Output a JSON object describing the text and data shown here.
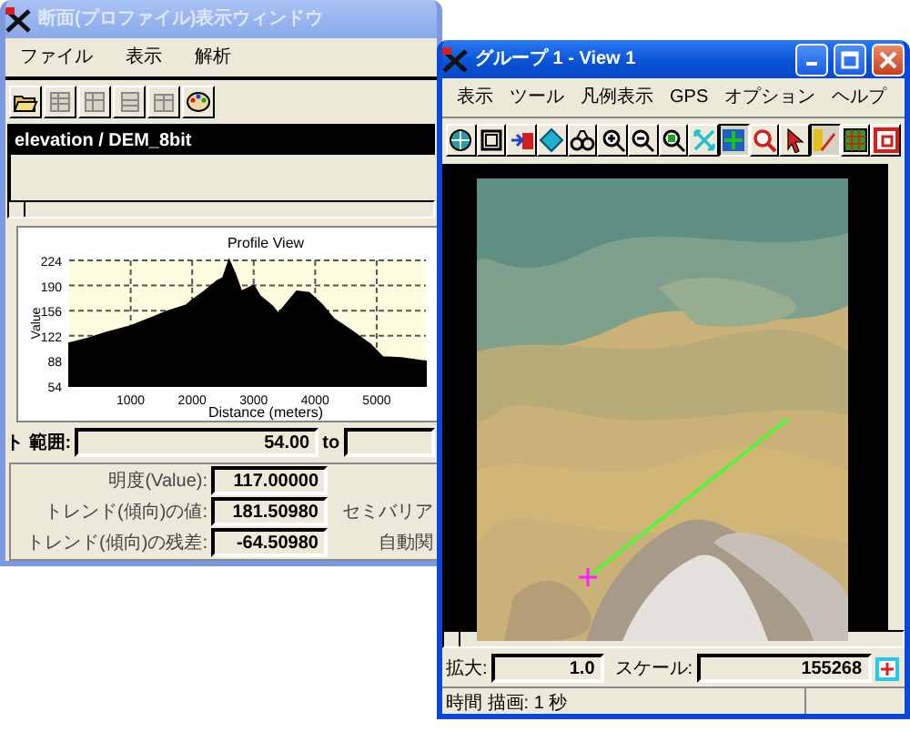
{
  "profile_window": {
    "title": "断面(プロファイル)表示ウィンドウ",
    "active": false,
    "menu": [
      "ファイル",
      "表示",
      "解析"
    ],
    "layers": [
      {
        "label": "elevation / DEM_8bit",
        "selected": true
      }
    ],
    "chart": {
      "chart_data": {
        "type": "area",
        "title": "Profile View",
        "xlabel": "Distance (meters)",
        "ylabel": "Value",
        "x": [
          0,
          300,
          600,
          1000,
          1300,
          1600,
          1900,
          2000,
          2200,
          2400,
          2500,
          2600,
          2700,
          2800,
          2900,
          3000,
          3100,
          3300,
          3400,
          3500,
          3700,
          3900,
          4100,
          4300,
          4600,
          4900,
          5100,
          5400,
          5800
        ],
        "values": [
          112,
          118,
          126,
          135,
          145,
          155,
          163,
          170,
          182,
          196,
          200,
          224,
          205,
          182,
          186,
          190,
          176,
          162,
          152,
          162,
          182,
          180,
          165,
          145,
          128,
          110,
          93,
          92,
          87
        ],
        "xlim": [
          0,
          5800
        ],
        "ylim": [
          54,
          224
        ],
        "grid": true,
        "xticks": [
          1000,
          2000,
          3000,
          4000,
          5000
        ],
        "yticks": [
          54,
          88,
          122,
          156,
          190,
          224
        ]
      }
    },
    "range": {
      "label": "ト 範囲:",
      "from": "54.00",
      "to_label": "to"
    },
    "values": [
      {
        "label": "明度(Value):",
        "value": "117.00000"
      },
      {
        "label": "トレンド(傾向)の値:",
        "value": "181.50980",
        "side_label": "セミバリア"
      },
      {
        "label": "トレンド(傾向)の残差:",
        "value": "-64.50980",
        "side_label": "自動関"
      }
    ]
  },
  "view_window": {
    "title": "グループ 1 - View 1",
    "active": true,
    "menu": [
      "表示",
      "ツール",
      "凡例表示",
      "GPS",
      "オプション",
      "ヘルプ"
    ],
    "zoom": {
      "label": "拡大:",
      "value": "1.0"
    },
    "scale": {
      "label": "スケール:",
      "value": "155268"
    },
    "status": "時間 描画: 1 秒"
  }
}
